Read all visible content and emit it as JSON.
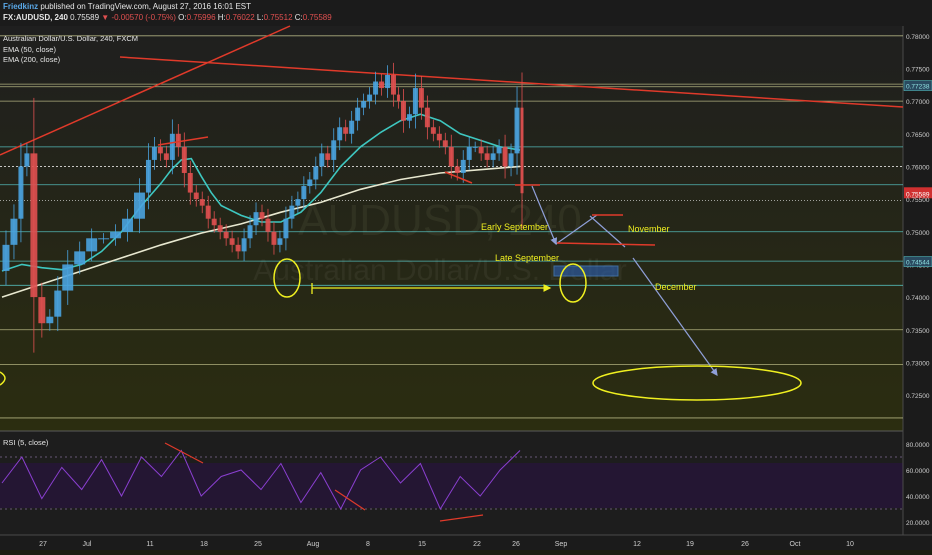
{
  "header": {
    "author": "Friedkinz",
    "published_text": "published on TradingView.com, August 27, 2016 16:01 EST",
    "symbol": "FX:AUDUSD, 240",
    "last": "0.75589",
    "change": "▼ -0.00570 (-0.75%)",
    "ohlc_o_label": "O:",
    "ohlc_o": "0.75996",
    "ohlc_h_label": "H:",
    "ohlc_h": "0.76022",
    "ohlc_l_label": "L:",
    "ohlc_l": "0.75512",
    "ohlc_c_label": "C:",
    "ohlc_c": "0.75589"
  },
  "legend": {
    "title": "Australian Dollar/U.S. Dollar, 240, FXCM",
    "ema50": "EMA (50, close)",
    "ema200": "EMA (200, close)",
    "rsi": "RSI (5, close)"
  },
  "watermark": {
    "symbol": "AUDUSD, 240",
    "name": "Australian Dollar/U.S. Dollar"
  },
  "annotations": {
    "early_sep": "Early September",
    "late_sep": "Late September",
    "november": "November",
    "december": "December"
  },
  "colors": {
    "background": "#1d1f0f",
    "price_line": "#4aa3df",
    "ema50": "#3ec7c0",
    "ema200": "#e8e8d0",
    "trend": "#e03a2a",
    "annotation": "#f0f020",
    "rsi": "#8a3fd0",
    "arrow": "#8f9fd8"
  },
  "chart_data": {
    "type": "line",
    "symbol": "AUDUSD",
    "price_axis": {
      "ylim": [
        0.7195,
        0.7815
      ],
      "ticks": [
        "0.78000",
        "0.77500",
        "0.77238",
        "0.77000",
        "0.76500",
        "0.76000",
        "0.75589",
        "0.75500",
        "0.75000",
        "0.74500",
        "0.74544",
        "0.74000",
        "0.73500",
        "0.73000",
        "0.72500"
      ]
    },
    "rsi_axis": {
      "ylim": [
        10,
        90
      ],
      "ticks": [
        "80.0000",
        "60.0000",
        "40.0000",
        "20.0000"
      ]
    },
    "x_axis": {
      "ticks": [
        "27",
        "Jul",
        "11",
        "18",
        "25",
        "Aug",
        "8",
        "15",
        "22",
        "26",
        "Sep",
        "12",
        "19",
        "26",
        "Oct",
        "10"
      ]
    },
    "price": {
      "x": [
        0,
        8,
        16,
        22,
        28,
        36,
        44,
        52,
        60,
        72,
        84,
        96,
        108,
        120,
        132,
        144,
        150,
        156,
        162,
        168,
        174,
        180,
        186,
        192,
        198,
        204,
        210,
        216,
        222,
        228,
        234,
        240,
        246,
        252,
        258,
        264,
        270,
        276,
        282,
        288,
        294,
        300,
        306,
        312,
        318,
        324,
        330,
        336,
        342,
        348,
        354,
        360,
        366,
        372,
        378,
        384,
        390,
        396,
        400,
        406,
        412,
        418,
        424,
        430,
        436,
        442,
        448,
        454,
        460,
        466,
        472,
        478,
        484,
        490,
        496,
        502,
        508,
        514,
        520,
        524
      ],
      "y": [
        0.744,
        0.748,
        0.752,
        0.76,
        0.762,
        0.74,
        0.736,
        0.737,
        0.741,
        0.745,
        0.747,
        0.749,
        0.749,
        0.75,
        0.752,
        0.756,
        0.761,
        0.763,
        0.762,
        0.761,
        0.765,
        0.763,
        0.759,
        0.756,
        0.755,
        0.754,
        0.752,
        0.751,
        0.75,
        0.749,
        0.748,
        0.747,
        0.749,
        0.751,
        0.753,
        0.752,
        0.75,
        0.748,
        0.749,
        0.752,
        0.754,
        0.755,
        0.757,
        0.758,
        0.76,
        0.762,
        0.761,
        0.764,
        0.766,
        0.765,
        0.767,
        0.769,
        0.77,
        0.771,
        0.773,
        0.772,
        0.774,
        0.771,
        0.77,
        0.767,
        0.768,
        0.772,
        0.769,
        0.766,
        0.765,
        0.764,
        0.763,
        0.76,
        0.759,
        0.761,
        0.763,
        0.763,
        0.762,
        0.761,
        0.762,
        0.763,
        0.76,
        0.762,
        0.769,
        0.7559
      ]
    },
    "ema50": {
      "x": [
        0,
        20,
        40,
        60,
        80,
        100,
        120,
        140,
        160,
        170,
        180,
        190,
        200,
        210,
        220,
        240,
        260,
        280,
        300,
        320,
        340,
        360,
        380,
        400,
        420,
        440,
        460,
        480,
        500,
        520
      ],
      "y": [
        0.744,
        0.745,
        0.7445,
        0.7442,
        0.745,
        0.747,
        0.75,
        0.754,
        0.7575,
        0.7595,
        0.761,
        0.7612,
        0.7585,
        0.756,
        0.754,
        0.7525,
        0.7515,
        0.7515,
        0.753,
        0.756,
        0.76,
        0.763,
        0.7652,
        0.767,
        0.768,
        0.767,
        0.765,
        0.764,
        0.763,
        0.7625
      ]
    },
    "ema200": {
      "x": [
        0,
        40,
        80,
        120,
        160,
        200,
        240,
        280,
        320,
        360,
        400,
        440,
        480,
        520
      ],
      "y": [
        0.74,
        0.742,
        0.744,
        0.746,
        0.748,
        0.7498,
        0.7512,
        0.753,
        0.7545,
        0.7565,
        0.758,
        0.759,
        0.7595,
        0.76
      ]
    },
    "rsi": {
      "x": [
        0,
        20,
        40,
        60,
        80,
        100,
        120,
        140,
        160,
        180,
        200,
        220,
        240,
        260,
        280,
        300,
        320,
        340,
        360,
        380,
        400,
        420,
        440,
        460,
        480,
        500,
        520
      ],
      "y": [
        50,
        70,
        38,
        62,
        45,
        68,
        40,
        70,
        55,
        75,
        40,
        55,
        60,
        45,
        65,
        35,
        58,
        30,
        60,
        70,
        50,
        65,
        30,
        55,
        40,
        60,
        75
      ]
    }
  }
}
